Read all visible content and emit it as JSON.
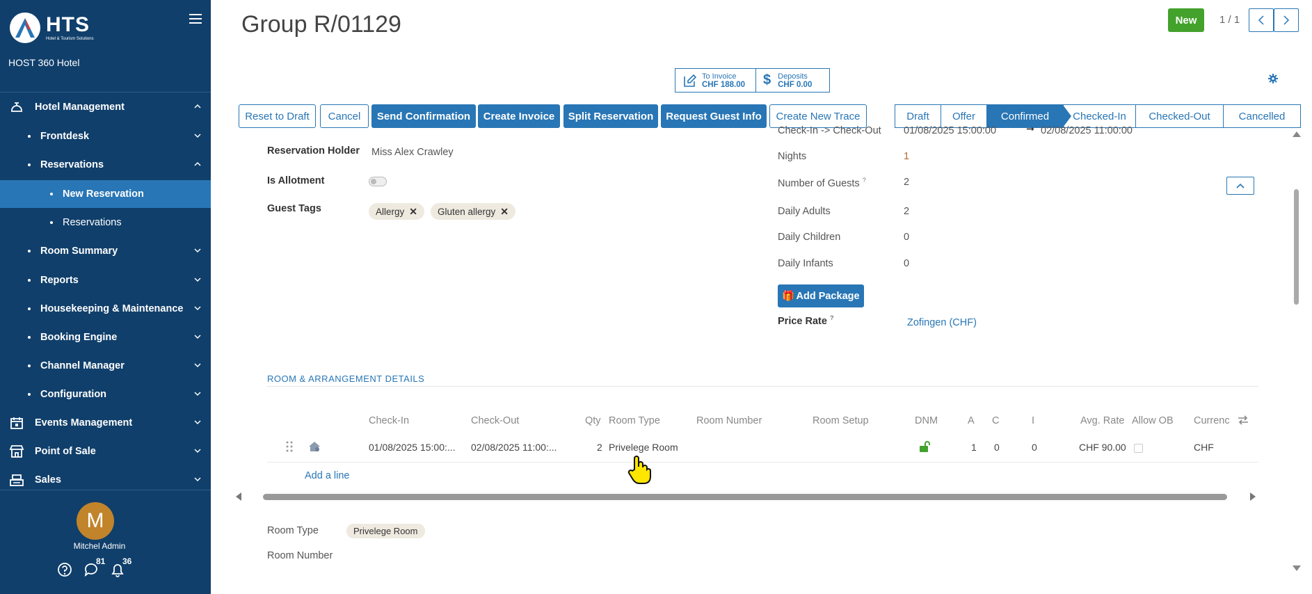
{
  "sidebar": {
    "logo_text": "HTS",
    "logo_subtext": "Hotel & Tourism Solutions",
    "hotel_name": "HOST 360 Hotel",
    "items": [
      {
        "label": "Hotel Management",
        "icon": "bell-hotel-icon"
      },
      {
        "label": "Frontdesk"
      },
      {
        "label": "Reservations"
      },
      {
        "label": "New Reservation"
      },
      {
        "label": "Reservations"
      },
      {
        "label": "Room Summary"
      },
      {
        "label": "Reports"
      },
      {
        "label": "Housekeeping & Maintenance"
      },
      {
        "label": "Booking Engine"
      },
      {
        "label": "Channel Manager"
      },
      {
        "label": "Configuration"
      },
      {
        "label": "Events Management",
        "icon": "calendar-icon"
      },
      {
        "label": "Point of Sale",
        "icon": "store-icon"
      },
      {
        "label": "Sales",
        "icon": "register-icon"
      }
    ],
    "user": {
      "initial": "M",
      "name": "Mitchel Admin"
    },
    "messages_count": "81",
    "notifications_count": "36"
  },
  "header": {
    "title": "Group R/01129",
    "new_label": "New",
    "pager": "1 / 1"
  },
  "stats": {
    "to_invoice_label": "To Invoice",
    "to_invoice_value": "CHF 188.00",
    "deposits_label": "Deposits",
    "deposits_value": "CHF 0.00"
  },
  "actions": {
    "reset": "Reset to Draft",
    "cancel": "Cancel",
    "send_confirmation": "Send Confirmation",
    "create_invoice": "Create Invoice",
    "split": "Split Reservation",
    "request_info": "Request Guest Info",
    "new_trace": "Create New Trace"
  },
  "statusbar": {
    "draft": "Draft",
    "offer": "Offer",
    "confirmed": "Confirmed",
    "checked_in": "Checked-In",
    "checked_out": "Checked-Out",
    "cancelled": "Cancelled"
  },
  "form": {
    "holder_label": "Reservation Holder",
    "holder_value": "Miss Alex Crawley",
    "allotment_label": "Is Allotment",
    "tags_label": "Guest Tags",
    "tags": [
      "Allergy",
      "Gluten allergy"
    ],
    "checkin_label": "Check-In -> Check-Out",
    "checkin_value": "01/08/2025 15:00:00",
    "checkout_value": "02/08/2025 11:00:00",
    "nights_label": "Nights",
    "nights_value": "1",
    "guests_label": "Number of Guests",
    "guests_value": "2",
    "adults_label": "Daily Adults",
    "adults_value": "2",
    "children_label": "Daily Children",
    "children_value": "0",
    "infants_label": "Daily Infants",
    "infants_value": "0",
    "add_package": "Add Package",
    "price_rate_label": "Price Rate",
    "price_rate_value": "Zofingen (CHF)",
    "q_mark": "?"
  },
  "room_section": {
    "title": "ROOM & ARRANGEMENT DETAILS",
    "columns": [
      "Check-In",
      "Check-Out",
      "Qty",
      "Room Type",
      "Room Number",
      "Room Setup",
      "DNM",
      "A",
      "C",
      "I",
      "Avg. Rate",
      "Allow OB",
      "Currenc"
    ],
    "row": {
      "checkin": "01/08/2025 15:00:...",
      "checkout": "02/08/2025 11:00:...",
      "qty": "2",
      "room_type": "Privelege Room",
      "a": "1",
      "c": "0",
      "i": "0",
      "avg_rate": "CHF 90.00",
      "currency": "CHF"
    },
    "add_line": "Add a line",
    "room_type_label": "Room Type",
    "room_type_chip": "Privelege Room",
    "room_number_label": "Room Number"
  },
  "colors": {
    "sidebar": "#103f6b",
    "accent": "#2876b5",
    "new_button": "#43a22c",
    "avatar": "#c1842b"
  }
}
